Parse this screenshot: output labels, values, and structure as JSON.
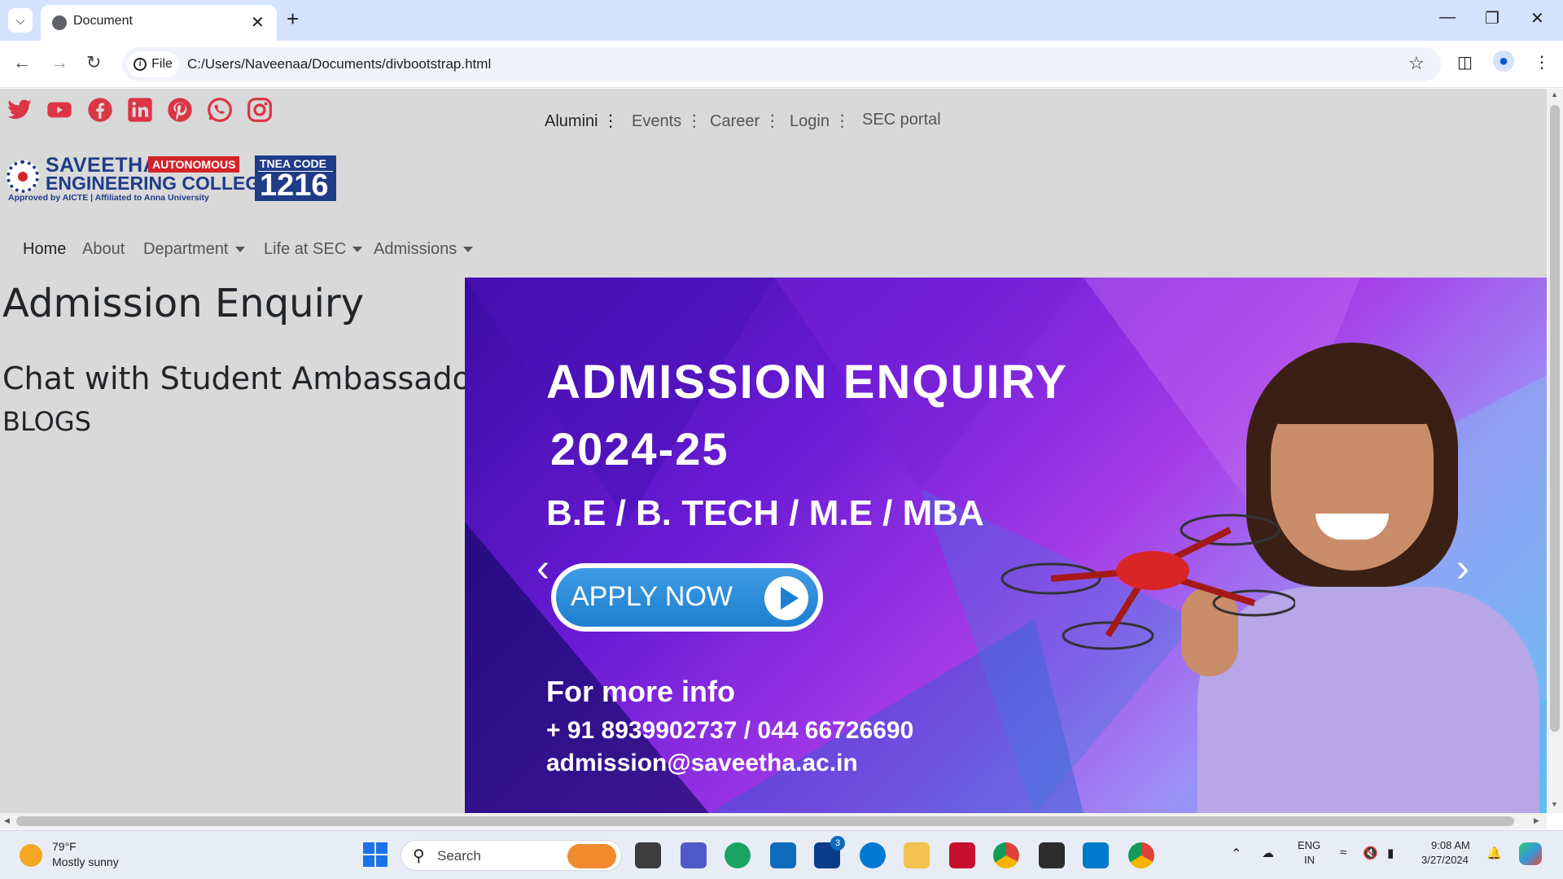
{
  "browser": {
    "tab_title": "Document",
    "site_chip": "File",
    "url": "C:/Users/Naveenaa/Documents/divbootstrap.html"
  },
  "page": {
    "top_nav": [
      {
        "label": "Alumini ⋮"
      },
      {
        "label": "Events ⋮"
      },
      {
        "label": "Career ⋮"
      },
      {
        "label": "Login ⋮"
      },
      {
        "label": "SEC portal"
      }
    ],
    "logo": {
      "name_line1": "SAVEETHA",
      "badge": "AUTONOMOUS",
      "name_line2": "ENGINEERING COLLEGE",
      "tagline": "Approved by AICTE | Affiliated to Anna University",
      "tnea_label": "TNEA CODE",
      "tnea_code": "1216"
    },
    "main_nav": [
      {
        "label": "Home",
        "dropdown": false
      },
      {
        "label": "About",
        "dropdown": false
      },
      {
        "label": "Department",
        "dropdown": true
      },
      {
        "label": "Life at SEC",
        "dropdown": true
      },
      {
        "label": "Admissions",
        "dropdown": true
      }
    ],
    "headings": {
      "h1": "Admission Enquiry",
      "h2": "Chat with Student Ambassador",
      "h3": "BLOGS"
    },
    "banner": {
      "title": "ADMISSION ENQUIRY",
      "year": "2024-25",
      "courses": "B.E / B. TECH / M.E / MBA",
      "apply_label": "APPLY NOW",
      "info_heading": "For more info",
      "phone": "+ 91 8939902737 / 044 66726690",
      "email": "admission@saveetha.ac.in"
    }
  },
  "taskbar": {
    "weather_temp": "79°F",
    "weather_desc": "Mostly sunny",
    "search_placeholder": "Search",
    "badge_count": "3",
    "lang_line1": "ENG",
    "lang_line2": "IN",
    "time": "9:08 AM",
    "date": "3/27/2024"
  },
  "colors": {
    "titlebar": "#d3e3fd",
    "page_bg": "#d9d9d9",
    "social_red": "#dc3545",
    "logo_blue": "#1f3c88",
    "logo_red": "#d3232a"
  }
}
